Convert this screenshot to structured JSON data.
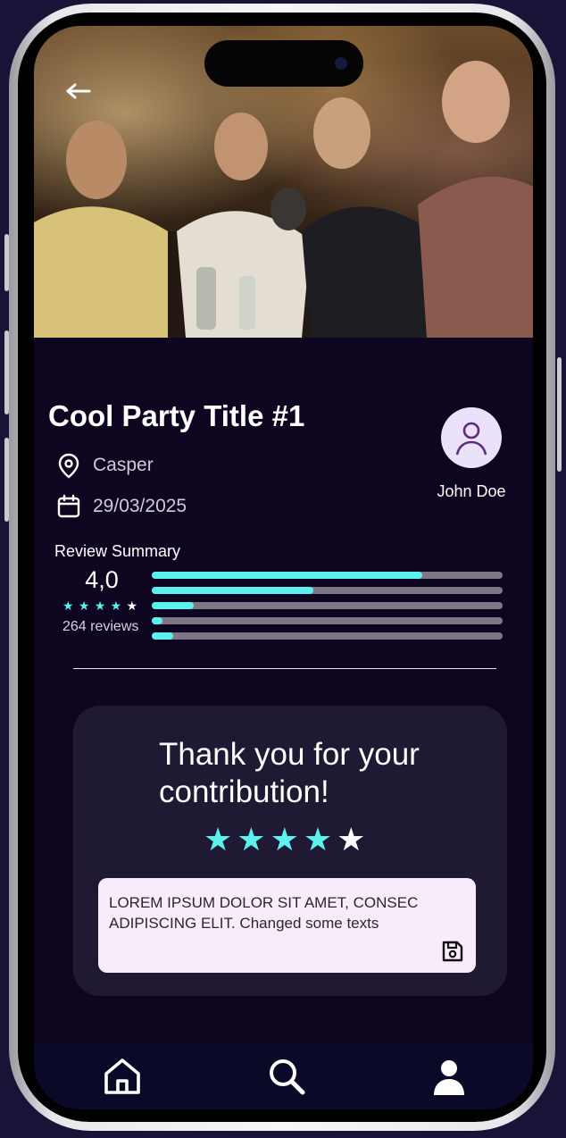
{
  "event": {
    "title": "Cool Party Title #1",
    "location": "Casper",
    "date": "29/03/2025"
  },
  "host": {
    "name": "John Doe",
    "icon": "user-avatar-icon"
  },
  "reviews": {
    "section_title": "Review Summary",
    "score": "4,0",
    "rating_stars_filled": 4,
    "rating_stars_total": 5,
    "count_label": "264 reviews",
    "distribution": [
      0.77,
      0.46,
      0.12,
      0.03,
      0.06
    ]
  },
  "feedback": {
    "title": "Thank you for your contribution!",
    "user_rating": 4,
    "stars_total": 5,
    "comment": "LOREM IPSUM DOLOR SIT AMET, CONSEC ADIPISCING ELIT. Changed some texts",
    "save_icon": "save-icon"
  },
  "nav": {
    "items": [
      {
        "icon": "home-icon"
      },
      {
        "icon": "search-icon"
      },
      {
        "icon": "profile-icon"
      }
    ]
  },
  "colors": {
    "background": "#0e0620",
    "accent": "#5cf0ef",
    "card": "#1f1933",
    "comment_box": "#f8ecfb",
    "avatar_bg": "#ece1fb",
    "nav_bg": "#0a0a28",
    "track": "#7d7686"
  }
}
